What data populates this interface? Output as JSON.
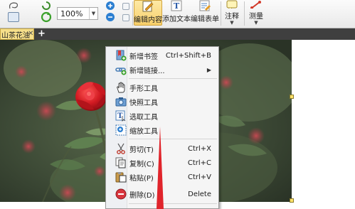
{
  "toolbar": {
    "zoom_value": "100%",
    "buttons": [
      {
        "label": "编辑内容",
        "icon": "edit-content-icon",
        "active": true
      },
      {
        "label": "添加文本",
        "icon": "add-text-icon",
        "active": false
      },
      {
        "label": "编辑表单",
        "icon": "edit-form-icon",
        "active": false
      },
      {
        "label": "注释",
        "icon": "annotation-icon",
        "active": false
      },
      {
        "label": "测量",
        "icon": "measure-icon",
        "active": false
      }
    ]
  },
  "tabs": {
    "active_label": "山茶花油"
  },
  "context_menu": {
    "items": [
      {
        "label": "新增书签",
        "shortcut": "Ctrl+Shift+B",
        "icon": "bookmark-add-icon"
      },
      {
        "label": "新增链接...",
        "shortcut": "",
        "icon": "link-add-icon",
        "submenu": true
      },
      {
        "label": "手形工具",
        "shortcut": "",
        "icon": "hand-tool-icon"
      },
      {
        "label": "快照工具",
        "shortcut": "",
        "icon": "snapshot-icon"
      },
      {
        "label": "选取工具",
        "shortcut": "",
        "icon": "select-text-icon"
      },
      {
        "label": "缩放工具",
        "shortcut": "",
        "icon": "zoom-tool-icon"
      },
      {
        "label": "剪切(T)",
        "shortcut": "Ctrl+X",
        "icon": "scissors-icon"
      },
      {
        "label": "复制(C)",
        "shortcut": "Ctrl+C",
        "icon": "copy-icon"
      },
      {
        "label": "粘贴(P)",
        "shortcut": "Ctrl+V",
        "icon": "paste-icon"
      },
      {
        "label": "删除(D)",
        "shortcut": "Delete",
        "icon": "delete-icon"
      }
    ]
  },
  "colors": {
    "active_button": "#f7cf6a",
    "tab_background": "#f6df8a",
    "tab_strip": "#3f3f3f",
    "arrow": "#e0242b",
    "flower": "#d21a22"
  }
}
